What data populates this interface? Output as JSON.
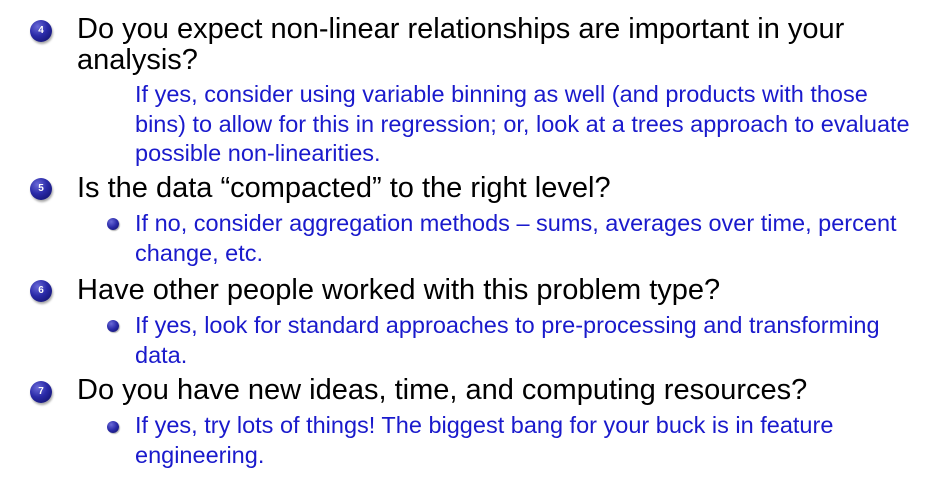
{
  "items": [
    {
      "number": "4",
      "question": "Do you expect non-linear relationships are important in your analysis?",
      "answer": "If yes, consider using variable binning as well (and products with those bins) to allow for this in regression; or, look at a trees approach to evaluate possible non-linearities."
    },
    {
      "number": "5",
      "question": "Is the data “compacted” to the right level?",
      "answer": "If no, consider aggregation methods – sums, averages over time, percent change, etc."
    },
    {
      "number": "6",
      "question": "Have other people worked with this problem type?",
      "answer": "If yes, look for standard approaches to pre-processing and transforming data."
    },
    {
      "number": "7",
      "question": "Do you have new ideas, time, and computing resources?",
      "answer": "If yes, try lots of things! The biggest bang for your buck is in feature engineering."
    }
  ],
  "colors": {
    "question_text": "#000000",
    "answer_text": "#1a1acc",
    "bullet": "#2a2aa8"
  }
}
